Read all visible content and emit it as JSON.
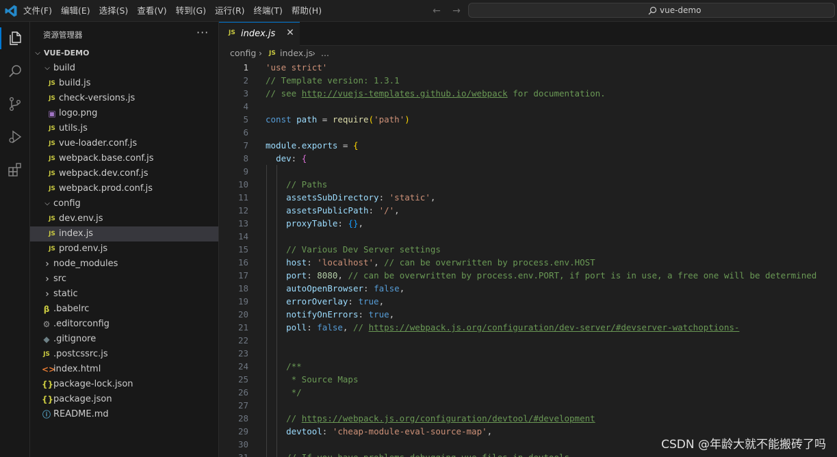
{
  "menu": [
    "文件(F)",
    "编辑(E)",
    "选择(S)",
    "查看(V)",
    "转到(G)",
    "运行(R)",
    "终端(T)",
    "帮助(H)"
  ],
  "search": {
    "text": "vue-demo"
  },
  "activity": {
    "icons": [
      "files-icon",
      "search-icon",
      "source-control-icon",
      "run-debug-icon",
      "extensions-icon"
    ]
  },
  "explorer": {
    "title": "资源管理器",
    "more": "···",
    "root": "VUE-DEMO",
    "items": [
      {
        "label": "build",
        "type": "folder",
        "open": true,
        "depth": 1
      },
      {
        "label": "build.js",
        "type": "js",
        "depth": 2
      },
      {
        "label": "check-versions.js",
        "type": "js",
        "depth": 2
      },
      {
        "label": "logo.png",
        "type": "image",
        "depth": 2
      },
      {
        "label": "utils.js",
        "type": "js",
        "depth": 2
      },
      {
        "label": "vue-loader.conf.js",
        "type": "js",
        "depth": 2
      },
      {
        "label": "webpack.base.conf.js",
        "type": "js",
        "depth": 2
      },
      {
        "label": "webpack.dev.conf.js",
        "type": "js",
        "depth": 2
      },
      {
        "label": "webpack.prod.conf.js",
        "type": "js",
        "depth": 2
      },
      {
        "label": "config",
        "type": "folder",
        "open": true,
        "depth": 1
      },
      {
        "label": "dev.env.js",
        "type": "js",
        "depth": 2
      },
      {
        "label": "index.js",
        "type": "js",
        "depth": 2,
        "selected": true
      },
      {
        "label": "prod.env.js",
        "type": "js",
        "depth": 2
      },
      {
        "label": "node_modules",
        "type": "folder",
        "open": false,
        "depth": 1
      },
      {
        "label": "src",
        "type": "folder",
        "open": false,
        "depth": 1
      },
      {
        "label": "static",
        "type": "folder",
        "open": false,
        "depth": 1
      },
      {
        "label": ".babelrc",
        "type": "babel",
        "depth": 1
      },
      {
        "label": ".editorconfig",
        "type": "gear",
        "depth": 1
      },
      {
        "label": ".gitignore",
        "type": "git",
        "depth": 1
      },
      {
        "label": ".postcssrc.js",
        "type": "js",
        "depth": 1
      },
      {
        "label": "index.html",
        "type": "html",
        "depth": 1
      },
      {
        "label": "package-lock.json",
        "type": "json",
        "depth": 1
      },
      {
        "label": "package.json",
        "type": "json",
        "depth": 1
      },
      {
        "label": "README.md",
        "type": "info",
        "depth": 1
      }
    ]
  },
  "tab": {
    "icon": "JS",
    "label": "index.js",
    "close": "✕"
  },
  "breadcrumb": {
    "folder": "config",
    "sep": "›",
    "icon": "JS",
    "file": "index.js",
    "sep2": "›",
    "more": "..."
  },
  "editor": {
    "active_line": 1,
    "lines": [
      {
        "n": "1",
        "parts": [
          [
            "t-str",
            "'use strict'"
          ]
        ]
      },
      {
        "n": "2",
        "parts": [
          [
            "t-com",
            "// Template version: 1.3.1"
          ]
        ]
      },
      {
        "n": "3",
        "parts": [
          [
            "t-com",
            "// see "
          ],
          [
            "t-com t-link",
            "http://vuejs-templates.github.io/webpack"
          ],
          [
            "t-com",
            " for documentation."
          ]
        ]
      },
      {
        "n": "4",
        "parts": []
      },
      {
        "n": "5",
        "parts": [
          [
            "t-key",
            "const "
          ],
          [
            "t-var",
            "path"
          ],
          [
            "",
            " = "
          ],
          [
            "t-fn",
            "require"
          ],
          [
            "t-br1",
            "("
          ],
          [
            "t-str",
            "'path'"
          ],
          [
            "t-br1",
            ")"
          ]
        ]
      },
      {
        "n": "6",
        "parts": []
      },
      {
        "n": "7",
        "parts": [
          [
            "t-var",
            "module"
          ],
          [
            "",
            "."
          ],
          [
            "t-var",
            "exports"
          ],
          [
            "",
            " = "
          ],
          [
            "t-br1",
            "{"
          ]
        ]
      },
      {
        "n": "8",
        "parts": [
          [
            "",
            "  "
          ],
          [
            "t-var",
            "dev"
          ],
          [
            "",
            ": "
          ],
          [
            "t-br2",
            "{"
          ]
        ]
      },
      {
        "n": "9",
        "parts": []
      },
      {
        "n": "10",
        "parts": [
          [
            "",
            "    "
          ],
          [
            "t-com",
            "// Paths"
          ]
        ]
      },
      {
        "n": "11",
        "parts": [
          [
            "",
            "    "
          ],
          [
            "t-var",
            "assetsSubDirectory"
          ],
          [
            "",
            ": "
          ],
          [
            "t-str",
            "'static'"
          ],
          [
            "",
            ","
          ]
        ]
      },
      {
        "n": "12",
        "parts": [
          [
            "",
            "    "
          ],
          [
            "t-var",
            "assetsPublicPath"
          ],
          [
            "",
            ": "
          ],
          [
            "t-str",
            "'/'"
          ],
          [
            "",
            ","
          ]
        ]
      },
      {
        "n": "13",
        "parts": [
          [
            "",
            "    "
          ],
          [
            "t-var",
            "proxyTable"
          ],
          [
            "",
            ": "
          ],
          [
            "t-br3",
            "{}"
          ],
          [
            "",
            ","
          ]
        ]
      },
      {
        "n": "14",
        "parts": []
      },
      {
        "n": "15",
        "parts": [
          [
            "",
            "    "
          ],
          [
            "t-com",
            "// Various Dev Server settings"
          ]
        ]
      },
      {
        "n": "16",
        "parts": [
          [
            "",
            "    "
          ],
          [
            "t-var",
            "host"
          ],
          [
            "",
            ": "
          ],
          [
            "t-str",
            "'localhost'"
          ],
          [
            "",
            ", "
          ],
          [
            "t-com",
            "// can be overwritten by process.env.HOST"
          ]
        ]
      },
      {
        "n": "17",
        "parts": [
          [
            "",
            "    "
          ],
          [
            "t-var",
            "port"
          ],
          [
            "",
            ": "
          ],
          [
            "t-num",
            "8080"
          ],
          [
            "",
            ", "
          ],
          [
            "t-com",
            "// can be overwritten by process.env.PORT, if port is in use, a free one will be determined"
          ]
        ]
      },
      {
        "n": "18",
        "parts": [
          [
            "",
            "    "
          ],
          [
            "t-var",
            "autoOpenBrowser"
          ],
          [
            "",
            ": "
          ],
          [
            "t-key",
            "false"
          ],
          [
            "",
            ","
          ]
        ]
      },
      {
        "n": "19",
        "parts": [
          [
            "",
            "    "
          ],
          [
            "t-var",
            "errorOverlay"
          ],
          [
            "",
            ": "
          ],
          [
            "t-key",
            "true"
          ],
          [
            "",
            ","
          ]
        ]
      },
      {
        "n": "20",
        "parts": [
          [
            "",
            "    "
          ],
          [
            "t-var",
            "notifyOnErrors"
          ],
          [
            "",
            ": "
          ],
          [
            "t-key",
            "true"
          ],
          [
            "",
            ","
          ]
        ]
      },
      {
        "n": "21",
        "parts": [
          [
            "",
            "    "
          ],
          [
            "t-var",
            "poll"
          ],
          [
            "",
            ": "
          ],
          [
            "t-key",
            "false"
          ],
          [
            "",
            ", "
          ],
          [
            "t-com",
            "// "
          ],
          [
            "t-com t-link",
            "https://webpack.js.org/configuration/dev-server/#devserver-watchoptions-"
          ]
        ]
      },
      {
        "n": "22",
        "parts": []
      },
      {
        "n": "23",
        "parts": []
      },
      {
        "n": "24",
        "parts": [
          [
            "",
            "    "
          ],
          [
            "t-com",
            "/**"
          ]
        ]
      },
      {
        "n": "25",
        "parts": [
          [
            "",
            "    "
          ],
          [
            "t-com",
            " * Source Maps"
          ]
        ]
      },
      {
        "n": "26",
        "parts": [
          [
            "",
            "    "
          ],
          [
            "t-com",
            " */"
          ]
        ]
      },
      {
        "n": "27",
        "parts": []
      },
      {
        "n": "28",
        "parts": [
          [
            "",
            "    "
          ],
          [
            "t-com",
            "// "
          ],
          [
            "t-com t-link",
            "https://webpack.js.org/configuration/devtool/#development"
          ]
        ]
      },
      {
        "n": "29",
        "parts": [
          [
            "",
            "    "
          ],
          [
            "t-var",
            "devtool"
          ],
          [
            "",
            ": "
          ],
          [
            "t-str",
            "'cheap-module-eval-source-map'"
          ],
          [
            "",
            ","
          ]
        ]
      },
      {
        "n": "30",
        "parts": []
      },
      {
        "n": "31",
        "parts": [
          [
            "",
            "    "
          ],
          [
            "t-com",
            "// If you have problems debugging vue-files in devtools,"
          ]
        ]
      }
    ]
  },
  "watermark": "CSDN @年龄大就不能搬砖了吗",
  "colors": {
    "accent": "#0078d4",
    "js_icon": "#cbcb41",
    "selected_row": "#37373d"
  }
}
